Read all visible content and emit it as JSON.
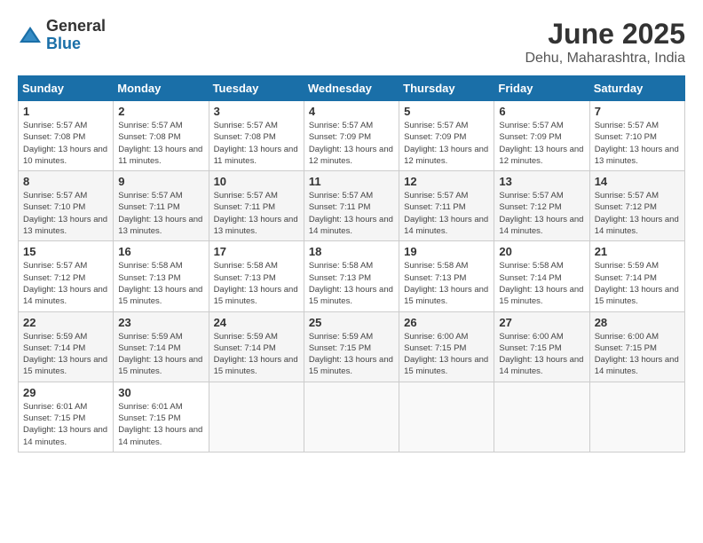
{
  "header": {
    "logo_general": "General",
    "logo_blue": "Blue",
    "title": "June 2025",
    "location": "Dehu, Maharashtra, India"
  },
  "calendar": {
    "days_of_week": [
      "Sunday",
      "Monday",
      "Tuesday",
      "Wednesday",
      "Thursday",
      "Friday",
      "Saturday"
    ],
    "weeks": [
      [
        {
          "day": "",
          "info": ""
        },
        {
          "day": "2",
          "info": "Sunrise: 5:57 AM\nSunset: 7:08 PM\nDaylight: 13 hours and 11 minutes."
        },
        {
          "day": "3",
          "info": "Sunrise: 5:57 AM\nSunset: 7:08 PM\nDaylight: 13 hours and 11 minutes."
        },
        {
          "day": "4",
          "info": "Sunrise: 5:57 AM\nSunset: 7:09 PM\nDaylight: 13 hours and 12 minutes."
        },
        {
          "day": "5",
          "info": "Sunrise: 5:57 AM\nSunset: 7:09 PM\nDaylight: 13 hours and 12 minutes."
        },
        {
          "day": "6",
          "info": "Sunrise: 5:57 AM\nSunset: 7:09 PM\nDaylight: 13 hours and 12 minutes."
        },
        {
          "day": "7",
          "info": "Sunrise: 5:57 AM\nSunset: 7:10 PM\nDaylight: 13 hours and 13 minutes."
        }
      ],
      [
        {
          "day": "8",
          "info": "Sunrise: 5:57 AM\nSunset: 7:10 PM\nDaylight: 13 hours and 13 minutes."
        },
        {
          "day": "9",
          "info": "Sunrise: 5:57 AM\nSunset: 7:11 PM\nDaylight: 13 hours and 13 minutes."
        },
        {
          "day": "10",
          "info": "Sunrise: 5:57 AM\nSunset: 7:11 PM\nDaylight: 13 hours and 13 minutes."
        },
        {
          "day": "11",
          "info": "Sunrise: 5:57 AM\nSunset: 7:11 PM\nDaylight: 13 hours and 14 minutes."
        },
        {
          "day": "12",
          "info": "Sunrise: 5:57 AM\nSunset: 7:11 PM\nDaylight: 13 hours and 14 minutes."
        },
        {
          "day": "13",
          "info": "Sunrise: 5:57 AM\nSunset: 7:12 PM\nDaylight: 13 hours and 14 minutes."
        },
        {
          "day": "14",
          "info": "Sunrise: 5:57 AM\nSunset: 7:12 PM\nDaylight: 13 hours and 14 minutes."
        }
      ],
      [
        {
          "day": "15",
          "info": "Sunrise: 5:57 AM\nSunset: 7:12 PM\nDaylight: 13 hours and 14 minutes."
        },
        {
          "day": "16",
          "info": "Sunrise: 5:58 AM\nSunset: 7:13 PM\nDaylight: 13 hours and 15 minutes."
        },
        {
          "day": "17",
          "info": "Sunrise: 5:58 AM\nSunset: 7:13 PM\nDaylight: 13 hours and 15 minutes."
        },
        {
          "day": "18",
          "info": "Sunrise: 5:58 AM\nSunset: 7:13 PM\nDaylight: 13 hours and 15 minutes."
        },
        {
          "day": "19",
          "info": "Sunrise: 5:58 AM\nSunset: 7:13 PM\nDaylight: 13 hours and 15 minutes."
        },
        {
          "day": "20",
          "info": "Sunrise: 5:58 AM\nSunset: 7:14 PM\nDaylight: 13 hours and 15 minutes."
        },
        {
          "day": "21",
          "info": "Sunrise: 5:59 AM\nSunset: 7:14 PM\nDaylight: 13 hours and 15 minutes."
        }
      ],
      [
        {
          "day": "22",
          "info": "Sunrise: 5:59 AM\nSunset: 7:14 PM\nDaylight: 13 hours and 15 minutes."
        },
        {
          "day": "23",
          "info": "Sunrise: 5:59 AM\nSunset: 7:14 PM\nDaylight: 13 hours and 15 minutes."
        },
        {
          "day": "24",
          "info": "Sunrise: 5:59 AM\nSunset: 7:14 PM\nDaylight: 13 hours and 15 minutes."
        },
        {
          "day": "25",
          "info": "Sunrise: 5:59 AM\nSunset: 7:15 PM\nDaylight: 13 hours and 15 minutes."
        },
        {
          "day": "26",
          "info": "Sunrise: 6:00 AM\nSunset: 7:15 PM\nDaylight: 13 hours and 15 minutes."
        },
        {
          "day": "27",
          "info": "Sunrise: 6:00 AM\nSunset: 7:15 PM\nDaylight: 13 hours and 14 minutes."
        },
        {
          "day": "28",
          "info": "Sunrise: 6:00 AM\nSunset: 7:15 PM\nDaylight: 13 hours and 14 minutes."
        }
      ],
      [
        {
          "day": "29",
          "info": "Sunrise: 6:01 AM\nSunset: 7:15 PM\nDaylight: 13 hours and 14 minutes."
        },
        {
          "day": "30",
          "info": "Sunrise: 6:01 AM\nSunset: 7:15 PM\nDaylight: 13 hours and 14 minutes."
        },
        {
          "day": "",
          "info": ""
        },
        {
          "day": "",
          "info": ""
        },
        {
          "day": "",
          "info": ""
        },
        {
          "day": "",
          "info": ""
        },
        {
          "day": "",
          "info": ""
        }
      ]
    ],
    "week0_day1": {
      "day": "1",
      "info": "Sunrise: 5:57 AM\nSunset: 7:08 PM\nDaylight: 13 hours and 10 minutes."
    }
  }
}
